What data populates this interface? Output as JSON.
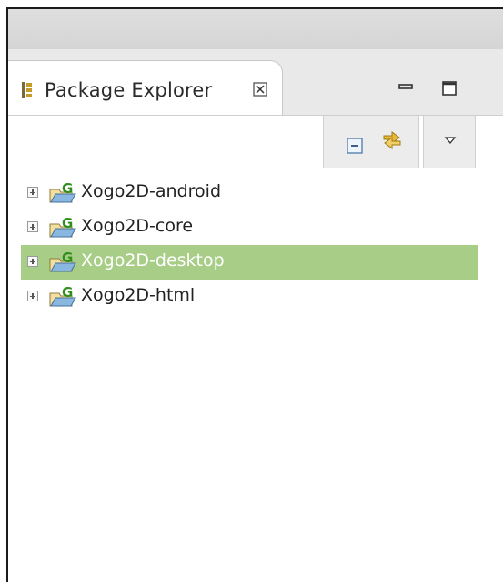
{
  "view": {
    "title": "Package Explorer",
    "tab_icon": "package-explorer-icon",
    "close_icon": "close-icon",
    "minimize_icon": "minimize-icon",
    "maximize_icon": "maximize-icon"
  },
  "toolbar": {
    "collapse_all_icon": "collapse-all-icon",
    "link_with_editor_icon": "link-with-editor-icon",
    "view_menu_icon": "chevron-down-icon"
  },
  "tree": {
    "items": [
      {
        "label": "Xogo2D-android",
        "selected": false,
        "icon": "gradle-project-icon"
      },
      {
        "label": "Xogo2D-core",
        "selected": false,
        "icon": "gradle-project-icon"
      },
      {
        "label": "Xogo2D-desktop",
        "selected": true,
        "icon": "gradle-project-icon"
      },
      {
        "label": "Xogo2D-html",
        "selected": false,
        "icon": "gradle-project-icon"
      }
    ]
  },
  "colors": {
    "selection": "#a7cd86",
    "gradle_green": "#2f8d1c"
  }
}
